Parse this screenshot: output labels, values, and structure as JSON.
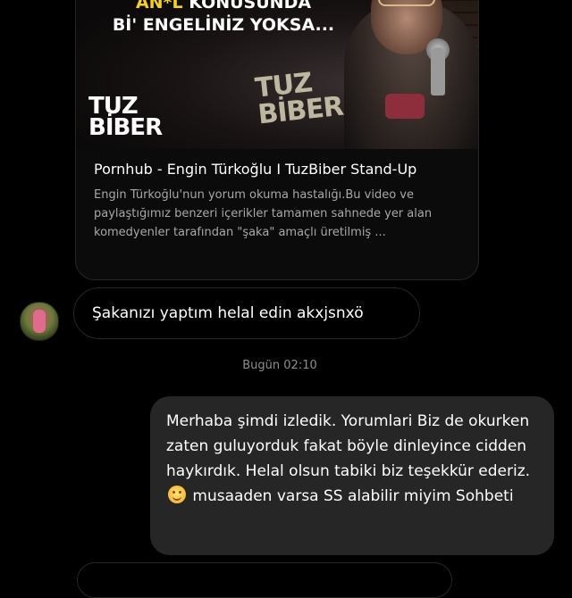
{
  "link_preview": {
    "thumbnail": {
      "headline_part1": "AN*L",
      "headline_part1b": " KONUSUNDA",
      "headline_part2": "Bİ' ENGELİNİZ YOKSA...",
      "logo_text": "TUZ BİBER",
      "sign_text": "TUZ BİBER"
    },
    "title": "Pornhub - Engin Türkoğlu I TuzBiber Stand-Up",
    "description": "Engin Türkoğlu'nun yorum okuma hastalığı.Bu video ve paylaştığımız benzeri içerikler tamamen sahnede yer alan komedyenler tarafından \"şaka\" amaçlı üretilmiş ..."
  },
  "incoming_message": {
    "text": "Şakanızı yaptım helal edin akxjsnxö"
  },
  "timestamp": "Bugün 02:10",
  "outgoing_message": {
    "text_before_emoji": "Merhaba şimdi izledik. Yorumlari Biz de okurken zaten  guluyorduk fakat böyle dinleyince cidden haykırdık. Helal olsun tabiki biz teşekkür ederiz. ",
    "emoji": "smiling-face-emoji",
    "text_after_emoji": " musaaden varsa SS alabilir miyim Sohbeti"
  },
  "colors": {
    "background": "#000000",
    "outgoing_bubble": "#262626",
    "bubble_border": "#262626",
    "secondary_text": "#a8a8a8",
    "timestamp_text": "#8e8e8e",
    "headline_yellow": "#f3d21b"
  }
}
